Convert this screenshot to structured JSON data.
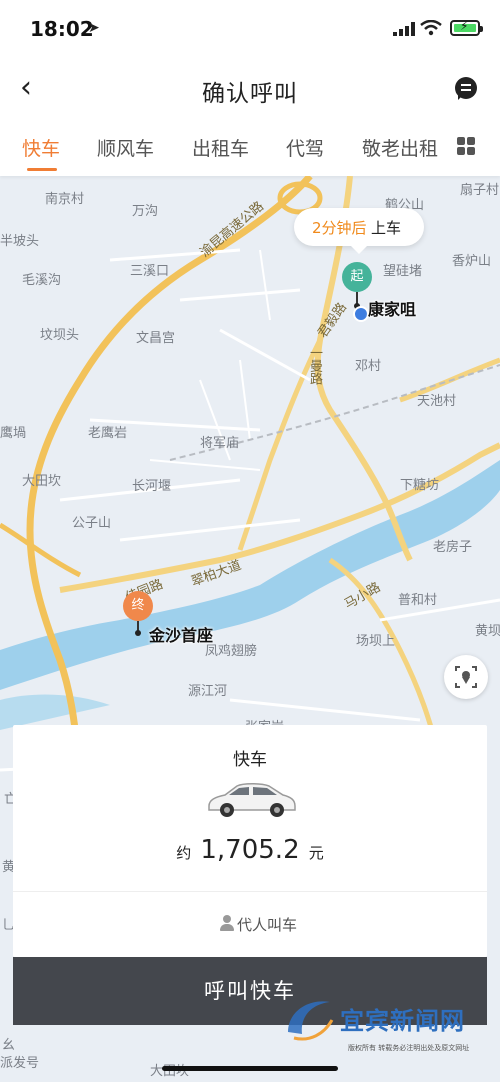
{
  "status_bar": {
    "time": "18:02"
  },
  "header": {
    "title": "确认呼叫"
  },
  "tabs": [
    {
      "label": "快车",
      "active": true
    },
    {
      "label": "顺风车",
      "active": false
    },
    {
      "label": "出租车",
      "active": false
    },
    {
      "label": "代驾",
      "active": false
    },
    {
      "label": "敬老出租",
      "active": false
    }
  ],
  "map": {
    "places": [
      "南京村",
      "万沟",
      "鹤公山",
      "扇子村",
      "半坡头",
      "三溪口",
      "香炉山",
      "毛溪沟",
      "望硅堵",
      "坟坝头",
      "文昌宫",
      "邓村",
      "天池村",
      "老鹰岩",
      "将军庙",
      "下糖坊",
      "大田坎",
      "长河堰",
      "公子山",
      "老房子",
      "普和村",
      "场坝上",
      "黄坝",
      "源江河",
      "凤鸡翅膀",
      "张家岩",
      "鹰堝",
      "亡",
      "黄",
      "乚",
      "幺",
      "大田坎",
      "派发号"
    ],
    "roads": [
      "渝昆高速公路",
      "君毅路",
      "一曼路",
      "翠柏大道",
      "佳园路",
      "马小路"
    ],
    "eta_text": "2分钟后",
    "eta_suffix": "上车",
    "start": {
      "pin": "起",
      "label": "康家咀",
      "color": "#45b39a"
    },
    "end": {
      "pin": "终",
      "label": "金沙首座",
      "color": "#f0884b"
    }
  },
  "panel": {
    "product": "快车",
    "price_prefix": "约",
    "price": "1,705.2",
    "price_unit": "元",
    "proxy_call": "代人叫车",
    "call_button": "呼叫快车"
  },
  "watermark": {
    "text": "宜宾新闻网",
    "sub": "版权所有  转载务必注明出处及原文网址"
  },
  "colors": {
    "accent": "#f07d34",
    "button": "#44474d",
    "river": "#9ed0ec",
    "road": "#f4d37f"
  }
}
